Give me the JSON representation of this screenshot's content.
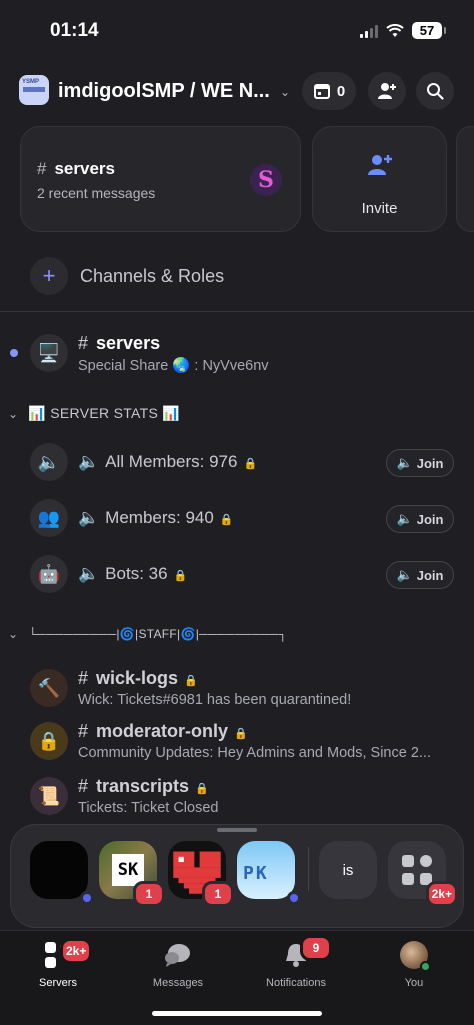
{
  "status_bar": {
    "time": "01:14",
    "battery": "57"
  },
  "header": {
    "server_name": "imdigoolSMP / WE N...",
    "server_icon_text": "YSMP",
    "events_count": "0"
  },
  "cards": {
    "recent": {
      "title": "servers",
      "subtitle": "2 recent messages",
      "avatar_letter": "S"
    },
    "invite": {
      "label": "Invite"
    }
  },
  "channels_roles": {
    "label": "Channels & Roles"
  },
  "channels_top": [
    {
      "name": "servers",
      "subtitle": "Special Share 🌏 : NyVve6nv",
      "avatar": "🖥️",
      "unread": true
    }
  ],
  "category_stats": {
    "label": "📊 SERVER STATS 📊"
  },
  "voice_channels": [
    {
      "name": "All Members: 976",
      "avatar": "🔈",
      "join": "Join"
    },
    {
      "name": "Members: 940",
      "avatar": "👥",
      "join": "Join"
    },
    {
      "name": "Bots: 36",
      "avatar": "🤖",
      "join": "Join"
    }
  ],
  "category_staff": {
    "label": "└─────────|🌀|STAFF|🌀|─────────┐"
  },
  "staff_channels": [
    {
      "name": "wick-logs",
      "subtitle": "Wick: Tickets#6981 has been quarantined!",
      "avatar": "🔨"
    },
    {
      "name": "moderator-only",
      "subtitle": "Community Updates: Hey Admins and Mods,  Since 2...",
      "avatar": "🔒"
    },
    {
      "name": "transcripts",
      "subtitle": "Tickets: Ticket Closed",
      "avatar": "📜"
    }
  ],
  "dock": {
    "items": [
      {
        "name": "dark-server",
        "badge": ""
      },
      {
        "name": "sk-server",
        "text": "SK",
        "badge": "1"
      },
      {
        "name": "heart-server",
        "badge": "1"
      },
      {
        "name": "pk-server",
        "text": "PK",
        "badge": ""
      }
    ],
    "is_label": "is",
    "folder_badge": "2k+"
  },
  "tabs": [
    {
      "label": "Servers",
      "badge": "2k+"
    },
    {
      "label": "Messages"
    },
    {
      "label": "Notifications",
      "badge": "9"
    },
    {
      "label": "You"
    }
  ]
}
